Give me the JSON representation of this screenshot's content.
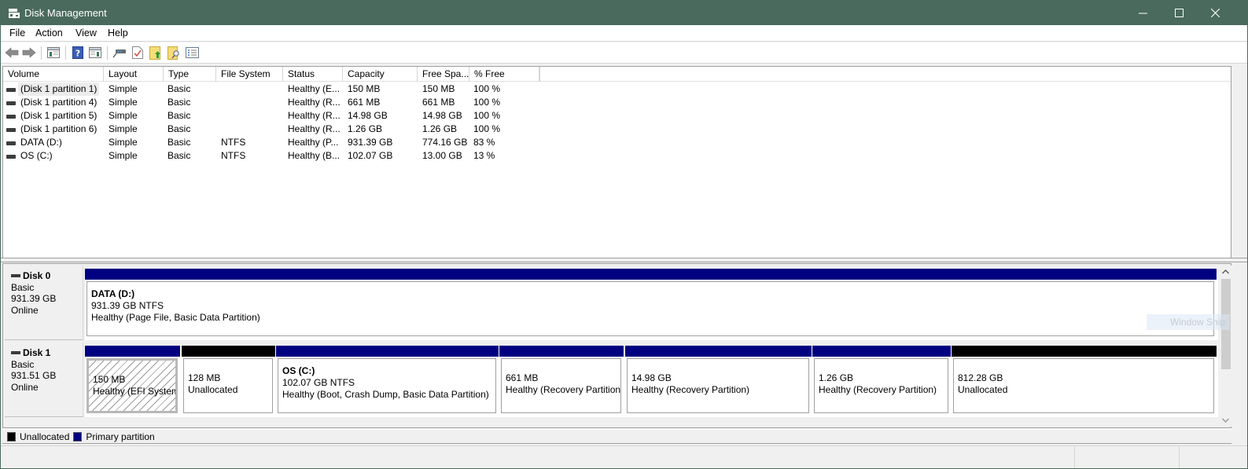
{
  "window": {
    "title": "Disk Management",
    "controls": {
      "minimize": "—",
      "maximize": "☐",
      "close": "✕"
    }
  },
  "menu": {
    "items": [
      "File",
      "Action",
      "View",
      "Help"
    ]
  },
  "toolbar": {
    "buttons": [
      {
        "name": "back",
        "icon": "back-arrow-icon"
      },
      {
        "name": "forward",
        "icon": "forward-arrow-icon"
      },
      {
        "name": "show-hide-console-tree",
        "icon": "console-tree-icon"
      },
      {
        "name": "help",
        "icon": "help-icon"
      },
      {
        "name": "show-hide-action-pane",
        "icon": "action-pane-icon"
      },
      {
        "name": "connect-virtual-disk",
        "icon": "disk-connect-icon"
      },
      {
        "name": "properties",
        "icon": "checklist-document-icon"
      },
      {
        "name": "export-list",
        "icon": "folder-up-icon"
      },
      {
        "name": "search",
        "icon": "folder-search-icon"
      },
      {
        "name": "settings-list",
        "icon": "list-view-icon"
      }
    ]
  },
  "volume_list": {
    "columns": [
      "Volume",
      "Layout",
      "Type",
      "File System",
      "Status",
      "Capacity",
      "Free Spa...",
      "% Free"
    ],
    "rows": [
      {
        "volume": "(Disk 1 partition 1)",
        "layout": "Simple",
        "type": "Basic",
        "fs": "",
        "status": "Healthy (E...",
        "capacity": "150 MB",
        "free": "150 MB",
        "pct": "100 %",
        "selected": true
      },
      {
        "volume": "(Disk 1 partition 4)",
        "layout": "Simple",
        "type": "Basic",
        "fs": "",
        "status": "Healthy (R...",
        "capacity": "661 MB",
        "free": "661 MB",
        "pct": "100 %"
      },
      {
        "volume": "(Disk 1 partition 5)",
        "layout": "Simple",
        "type": "Basic",
        "fs": "",
        "status": "Healthy (R...",
        "capacity": "14.98 GB",
        "free": "14.98 GB",
        "pct": "100 %"
      },
      {
        "volume": "(Disk 1 partition 6)",
        "layout": "Simple",
        "type": "Basic",
        "fs": "",
        "status": "Healthy (R...",
        "capacity": "1.26 GB",
        "free": "1.26 GB",
        "pct": "100 %"
      },
      {
        "volume": "DATA (D:)",
        "layout": "Simple",
        "type": "Basic",
        "fs": "NTFS",
        "status": "Healthy (P...",
        "capacity": "931.39 GB",
        "free": "774.16 GB",
        "pct": "83 %"
      },
      {
        "volume": "OS (C:)",
        "layout": "Simple",
        "type": "Basic",
        "fs": "NTFS",
        "status": "Healthy (B...",
        "capacity": "102.07 GB",
        "free": "13.00 GB",
        "pct": "13 %"
      }
    ]
  },
  "disks": [
    {
      "name": "Disk 0",
      "type": "Basic",
      "size": "931.39 GB",
      "state": "Online",
      "partitions": [
        {
          "kind": "primary",
          "name": "DATA  (D:)",
          "size": "931.39 GB NTFS",
          "status": "Healthy (Page File, Basic Data Partition)"
        }
      ]
    },
    {
      "name": "Disk 1",
      "type": "Basic",
      "size": "931.51 GB",
      "state": "Online",
      "partitions": [
        {
          "kind": "primary",
          "efi": true,
          "name": "",
          "size": "150 MB",
          "status": "Healthy (EFI System I"
        },
        {
          "kind": "unallocated",
          "name": "",
          "size": "128 MB",
          "status": "Unallocated"
        },
        {
          "kind": "primary",
          "name": "OS  (C:)",
          "size": "102.07 GB NTFS",
          "status": "Healthy (Boot, Crash Dump, Basic Data Partition)"
        },
        {
          "kind": "primary",
          "name": "",
          "size": "661 MB",
          "status": "Healthy (Recovery Partition)"
        },
        {
          "kind": "primary",
          "name": "",
          "size": "14.98 GB",
          "status": "Healthy (Recovery Partition)"
        },
        {
          "kind": "primary",
          "name": "",
          "size": "1.26 GB",
          "status": "Healthy (Recovery Partition)"
        },
        {
          "kind": "unallocated",
          "name": "",
          "size": "812.28 GB",
          "status": "Unallocated"
        }
      ]
    }
  ],
  "legend": [
    {
      "label": "Unallocated",
      "color": "#000000"
    },
    {
      "label": "Primary partition",
      "color": "#000080"
    }
  ],
  "overlay": {
    "watermark": "Window Snip"
  },
  "colors": {
    "titlebar": "#4a6a5e",
    "primary_partition": "#000080",
    "unallocated": "#000000"
  }
}
